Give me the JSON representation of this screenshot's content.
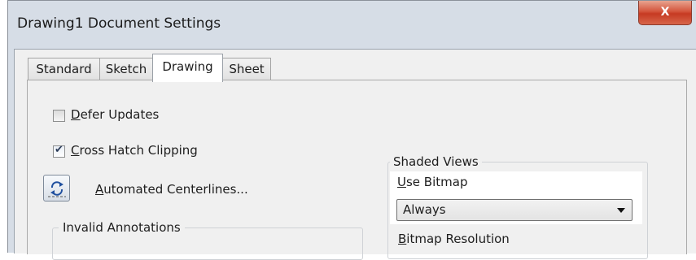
{
  "window": {
    "title": "Drawing1 Document Settings",
    "close_label": "X"
  },
  "tabs": [
    {
      "label": "Standard",
      "active": false
    },
    {
      "label": "Sketch",
      "active": false
    },
    {
      "label": "Drawing",
      "active": true
    },
    {
      "label": "Sheet",
      "active": false
    }
  ],
  "options": {
    "defer_updates": {
      "mnemonic": "D",
      "rest": "efer Updates",
      "checked": false
    },
    "cross_hatch_clipping": {
      "mnemonic": "C",
      "rest": "ross Hatch Clipping",
      "checked": true
    },
    "automated_centerlines": {
      "mnemonic": "A",
      "rest": "utomated Centerlines...",
      "icon": "centerline-icon"
    }
  },
  "invalid_annotations": {
    "title": "Invalid Annotations"
  },
  "shaded_views": {
    "title": "Shaded Views",
    "use_bitmap": {
      "mnemonic": "U",
      "rest": "se Bitmap",
      "selected": "Always"
    },
    "bitmap_resolution": {
      "mnemonic": "B",
      "rest": "itmap Resolution"
    }
  }
}
